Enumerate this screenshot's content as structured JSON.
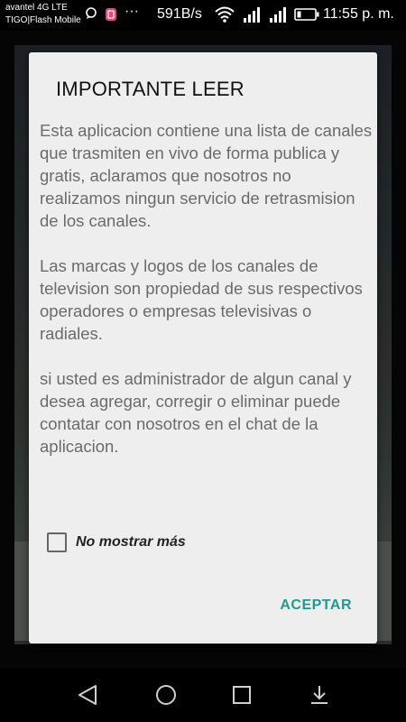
{
  "status_bar": {
    "carrier_line1": "avantel 4G LTE",
    "carrier_line2": "TIGO|Flash Mobile",
    "ellipsis": "···",
    "data_rate": "591B/s",
    "time": "11:55 p. m."
  },
  "dialog": {
    "title": "IMPORTANTE LEER",
    "paragraphs": [
      "Esta aplicacion contiene una lista de canales que trasmiten en vivo de forma publica y gratis, aclaramos que nosotros no realizamos ningun servicio de retrasmision de los canales.",
      "Las marcas y logos de los canales de television son propiedad de sus respectivos operadores o empresas televisivas o radiales.",
      "si usted es administrador de algun canal y desea agregar, corregir o eliminar puede contatar con nosotros en el chat de la aplicacion."
    ],
    "checkbox_label": "No mostrar más",
    "checkbox_checked": false,
    "accept_label": "ACEPTAR",
    "accent_color": "#1f9a8e"
  },
  "nav_bar": {
    "icons": [
      "back-icon",
      "home-icon",
      "recents-icon",
      "notification-pull-icon"
    ]
  }
}
